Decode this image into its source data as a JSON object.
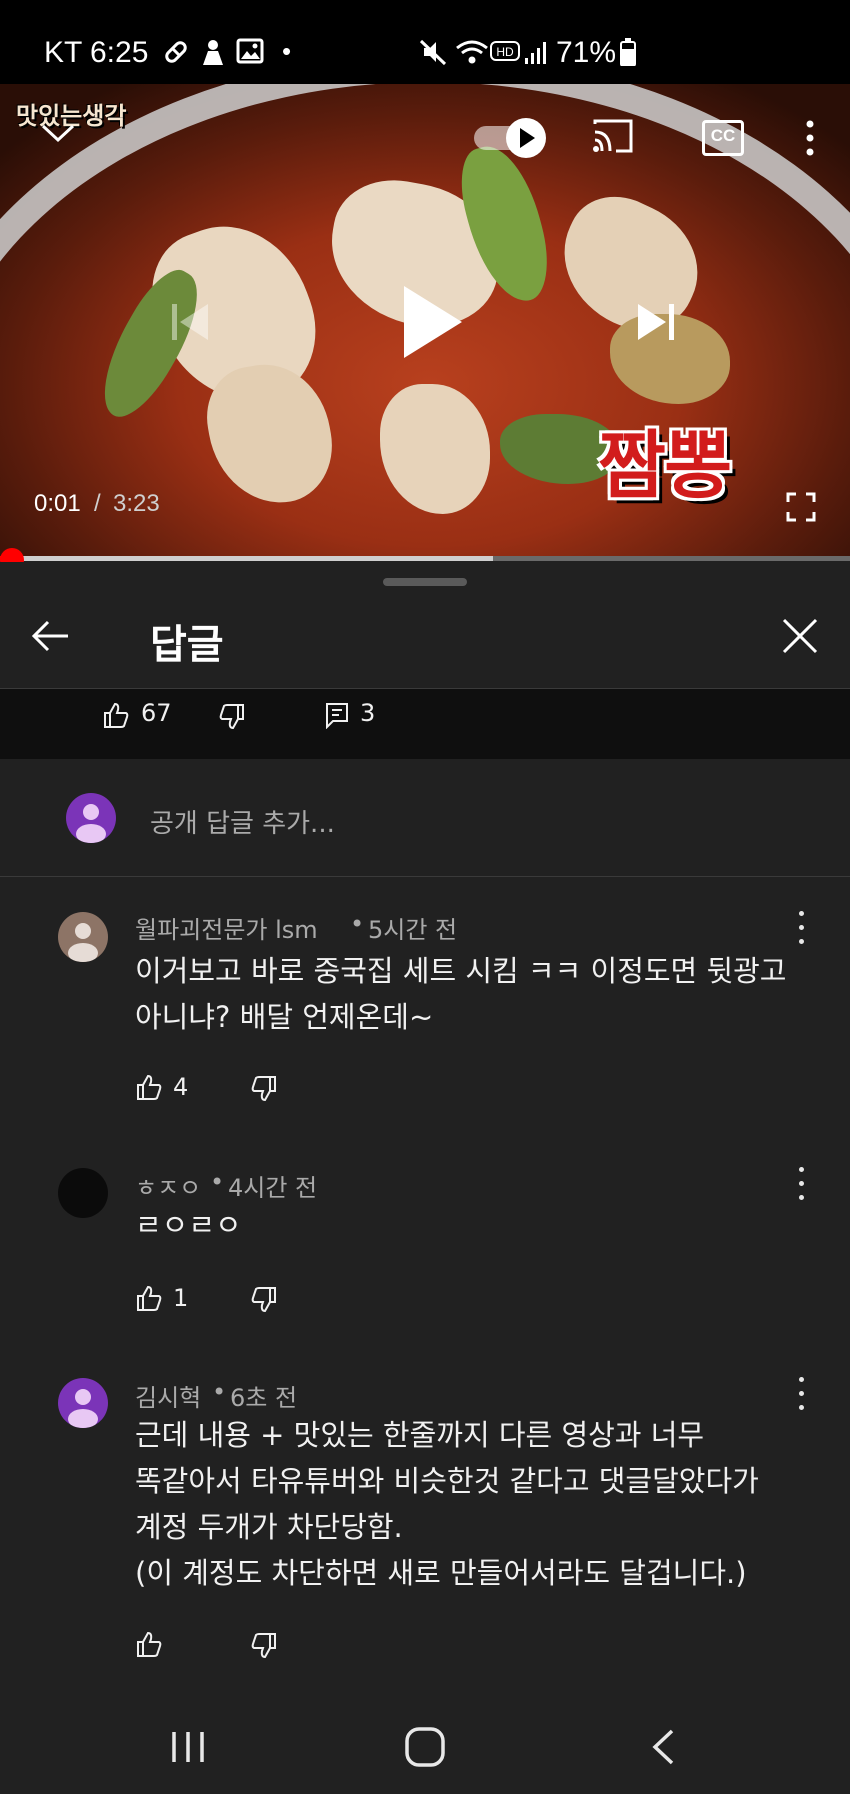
{
  "status_bar": {
    "carrier": "KT",
    "time": "6:25",
    "dot": "•",
    "battery": "71%",
    "icons": [
      "pill-icon",
      "person-icon",
      "image-icon",
      "mute-icon",
      "wifi-icon",
      "hd-icon",
      "signal-icon",
      "battery-icon"
    ]
  },
  "video": {
    "channel_watermark": "맛있는생각",
    "overlay_title": "짬뽕",
    "time_current": "0:01",
    "time_separator": "/",
    "time_total": "3:23",
    "progress_fraction": 0.003,
    "buffer_fraction": 0.58,
    "colors": {
      "progress": "#ff0000",
      "buffer": "#cfcfcf"
    },
    "icons": [
      "collapse-chevron-icon",
      "autoplay-toggle-icon",
      "cast-icon",
      "captions-icon",
      "more-vert-icon",
      "previous-icon",
      "play-icon",
      "next-icon",
      "fullscreen-icon"
    ],
    "cc_label": "CC"
  },
  "panel": {
    "title": "답글",
    "parent": {
      "likes": "67",
      "replies": "3"
    },
    "add_reply_placeholder": "공개 답글 추가..."
  },
  "replies": [
    {
      "author": "월파괴전문가 lsm",
      "time": "5시간 전",
      "lines": [
        "이거보고 바로 중국집 세트 시킴 ㅋㅋ 이정도면 뒷광고",
        "아니냐? 배달 언제온데~"
      ],
      "likes": "4",
      "avatar_color": "#8d7466"
    },
    {
      "author": "ㅎㅈㅇ",
      "time": "4시간 전",
      "lines": [
        "ㄹㅇㄹㅇ"
      ],
      "likes": "1",
      "avatar_color": "#0b0b0b"
    },
    {
      "author": "김시혁",
      "time": "6초 전",
      "lines": [
        "근데 내용 + 맛있는 한줄까지 다른 영상과 너무",
        "똑같아서 타유튜버와 비슷한것 같다고 댓글달았다가",
        "계정 두개가 차단당함.",
        "(이 계정도 차단하면 새로 만들어서라도 달겁니다.)"
      ],
      "likes": "",
      "avatar_color": "#7b34b8"
    }
  ],
  "meta_separator": "•",
  "nav_icons": [
    "recent-apps-icon",
    "home-icon",
    "back-icon"
  ]
}
